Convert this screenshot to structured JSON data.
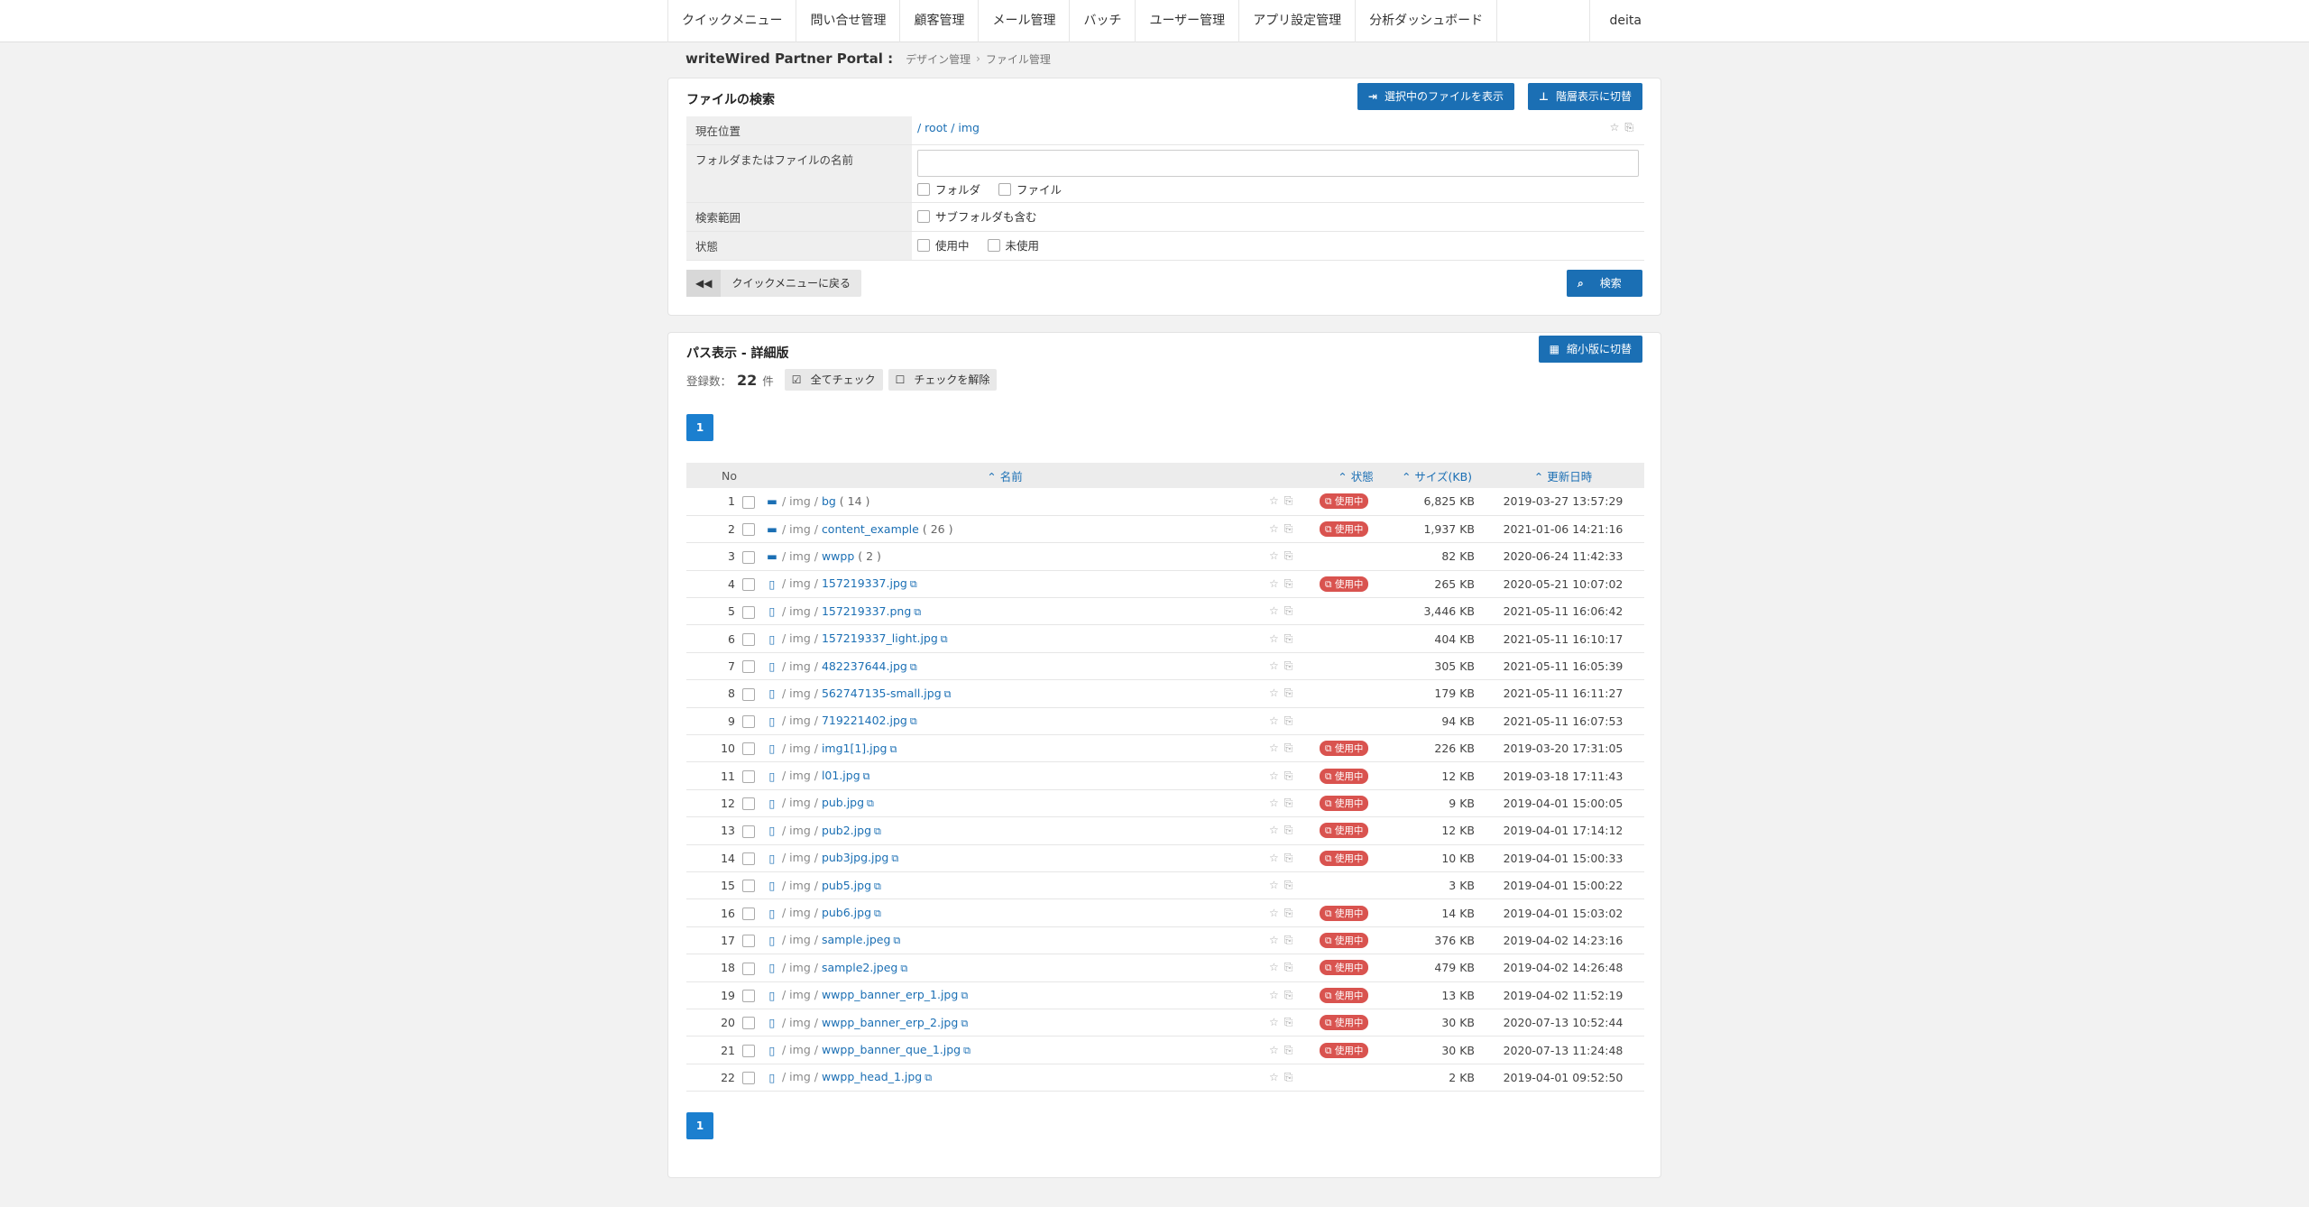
{
  "nav": {
    "items": [
      "クイックメニュー",
      "問い合せ管理",
      "顧客管理",
      "メール管理",
      "バッチ",
      "ユーザー管理",
      "アプリ設定管理",
      "分析ダッシュボード"
    ],
    "user": "deita"
  },
  "breadcrumb": {
    "title": "writeWired Partner Portal :",
    "items": [
      "デザイン管理",
      "ファイル管理"
    ]
  },
  "search": {
    "title": "ファイルの検索",
    "btn_show_selected": "選択中のファイルを表示",
    "btn_tree_view": "階層表示に切替",
    "rows": {
      "current_label": "現在位置",
      "current_path": "/ root / img",
      "name_label": "フォルダまたはファイルの名前",
      "name_value": "",
      "opt_folder": "フォルダ",
      "opt_file": "ファイル",
      "scope_label": "検索範囲",
      "scope_opt": "サブフォルダも含む",
      "status_label": "状態",
      "status_used": "使用中",
      "status_unused": "未使用"
    },
    "btn_back": "クイックメニューに戻る",
    "btn_search": "検索"
  },
  "list": {
    "title": "パス表示 - 詳細版",
    "btn_compact": "縮小版に切替",
    "count_label": "登録数：",
    "count": "22",
    "count_unit": "件",
    "btn_check_all": "全てチェック",
    "btn_uncheck": "チェックを解除",
    "page": "1",
    "headers": {
      "no": "No",
      "name": "名前",
      "status": "状態",
      "size": "サイズ(KB)",
      "date": "更新日時"
    },
    "rows": [
      {
        "no": "1",
        "type": "folder",
        "prefix": "/ img / ",
        "name": "bg",
        "count": "( 14 )",
        "used": true,
        "size": "6,825 KB",
        "date": "2019-03-27 13:57:29"
      },
      {
        "no": "2",
        "type": "folder",
        "prefix": "/ img / ",
        "name": "content_example",
        "count": "( 26 )",
        "used": true,
        "size": "1,937 KB",
        "date": "2021-01-06 14:21:16"
      },
      {
        "no": "3",
        "type": "folder",
        "prefix": "/ img / ",
        "name": "wwpp",
        "count": "( 2 )",
        "used": false,
        "size": "82 KB",
        "date": "2020-06-24 11:42:33"
      },
      {
        "no": "4",
        "type": "file",
        "prefix": "/ img / ",
        "name": "157219337.jpg",
        "count": "",
        "used": true,
        "size": "265 KB",
        "date": "2020-05-21 10:07:02"
      },
      {
        "no": "5",
        "type": "file",
        "prefix": "/ img / ",
        "name": "157219337.png",
        "count": "",
        "used": false,
        "size": "3,446 KB",
        "date": "2021-05-11 16:06:42"
      },
      {
        "no": "6",
        "type": "file",
        "prefix": "/ img / ",
        "name": "157219337_light.jpg",
        "count": "",
        "used": false,
        "size": "404 KB",
        "date": "2021-05-11 16:10:17"
      },
      {
        "no": "7",
        "type": "file",
        "prefix": "/ img / ",
        "name": "482237644.jpg",
        "count": "",
        "used": false,
        "size": "305 KB",
        "date": "2021-05-11 16:05:39"
      },
      {
        "no": "8",
        "type": "file",
        "prefix": "/ img / ",
        "name": "562747135-small.jpg",
        "count": "",
        "used": false,
        "size": "179 KB",
        "date": "2021-05-11 16:11:27"
      },
      {
        "no": "9",
        "type": "file",
        "prefix": "/ img / ",
        "name": "719221402.jpg",
        "count": "",
        "used": false,
        "size": "94 KB",
        "date": "2021-05-11 16:07:53"
      },
      {
        "no": "10",
        "type": "file",
        "prefix": "/ img / ",
        "name": "img1[1].jpg",
        "count": "",
        "used": true,
        "size": "226 KB",
        "date": "2019-03-20 17:31:05"
      },
      {
        "no": "11",
        "type": "file",
        "prefix": "/ img / ",
        "name": "l01.jpg",
        "count": "",
        "used": true,
        "size": "12 KB",
        "date": "2019-03-18 17:11:43"
      },
      {
        "no": "12",
        "type": "file",
        "prefix": "/ img / ",
        "name": "pub.jpg",
        "count": "",
        "used": true,
        "size": "9 KB",
        "date": "2019-04-01 15:00:05"
      },
      {
        "no": "13",
        "type": "file",
        "prefix": "/ img / ",
        "name": "pub2.jpg",
        "count": "",
        "used": true,
        "size": "12 KB",
        "date": "2019-04-01 17:14:12"
      },
      {
        "no": "14",
        "type": "file",
        "prefix": "/ img / ",
        "name": "pub3jpg.jpg",
        "count": "",
        "used": true,
        "size": "10 KB",
        "date": "2019-04-01 15:00:33"
      },
      {
        "no": "15",
        "type": "file",
        "prefix": "/ img / ",
        "name": "pub5.jpg",
        "count": "",
        "used": false,
        "size": "3 KB",
        "date": "2019-04-01 15:00:22"
      },
      {
        "no": "16",
        "type": "file",
        "prefix": "/ img / ",
        "name": "pub6.jpg",
        "count": "",
        "used": true,
        "size": "14 KB",
        "date": "2019-04-01 15:03:02"
      },
      {
        "no": "17",
        "type": "file",
        "prefix": "/ img / ",
        "name": "sample.jpeg",
        "count": "",
        "used": true,
        "size": "376 KB",
        "date": "2019-04-02 14:23:16"
      },
      {
        "no": "18",
        "type": "file",
        "prefix": "/ img / ",
        "name": "sample2.jpeg",
        "count": "",
        "used": true,
        "size": "479 KB",
        "date": "2019-04-02 14:26:48"
      },
      {
        "no": "19",
        "type": "file",
        "prefix": "/ img / ",
        "name": "wwpp_banner_erp_1.jpg",
        "count": "",
        "used": true,
        "size": "13 KB",
        "date": "2019-04-02 11:52:19"
      },
      {
        "no": "20",
        "type": "file",
        "prefix": "/ img / ",
        "name": "wwpp_banner_erp_2.jpg",
        "count": "",
        "used": true,
        "size": "30 KB",
        "date": "2020-07-13 10:52:44"
      },
      {
        "no": "21",
        "type": "file",
        "prefix": "/ img / ",
        "name": "wwpp_banner_que_1.jpg",
        "count": "",
        "used": true,
        "size": "30 KB",
        "date": "2020-07-13 11:24:48"
      },
      {
        "no": "22",
        "type": "file",
        "prefix": "/ img / ",
        "name": "wwpp_head_1.jpg",
        "count": "",
        "used": false,
        "size": "2 KB",
        "date": "2019-04-01 09:52:50"
      }
    ],
    "used_badge": "使用中"
  }
}
